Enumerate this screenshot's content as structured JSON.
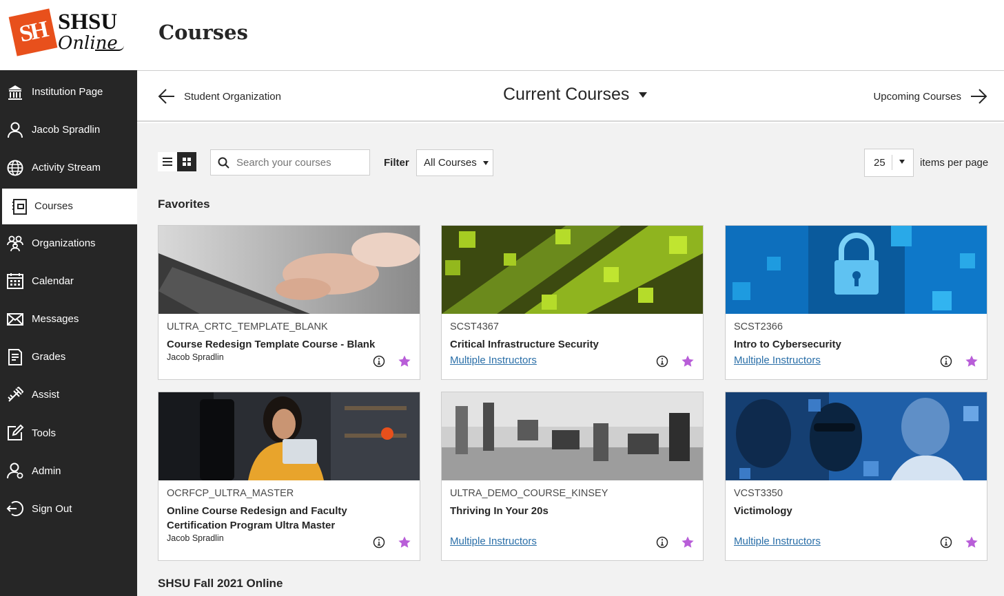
{
  "logo": {
    "mark": "SH",
    "line1": "SHSU",
    "line2": "Online"
  },
  "page_title": "Courses",
  "nav": [
    {
      "label": "Institution Page",
      "icon": "institution-icon"
    },
    {
      "label": "Jacob Spradlin",
      "icon": "user-icon"
    },
    {
      "label": "Activity Stream",
      "icon": "globe-icon"
    },
    {
      "label": "Courses",
      "icon": "courses-icon"
    },
    {
      "label": "Organizations",
      "icon": "organizations-icon"
    },
    {
      "label": "Calendar",
      "icon": "calendar-icon"
    },
    {
      "label": "Messages",
      "icon": "envelope-icon"
    },
    {
      "label": "Grades",
      "icon": "grades-icon"
    },
    {
      "label": "Assist",
      "icon": "assist-icon"
    },
    {
      "label": "Tools",
      "icon": "tools-icon"
    },
    {
      "label": "Admin",
      "icon": "admin-icon"
    },
    {
      "label": "Sign Out",
      "icon": "sign-out-icon"
    }
  ],
  "active_nav": "Courses",
  "term_nav": {
    "previous": "Student Organization",
    "current": "Current Courses",
    "next": "Upcoming Courses"
  },
  "toolbar": {
    "search_placeholder": "Search your courses",
    "filter_label": "Filter",
    "filter_value": "All Courses",
    "items_per_page_value": "25",
    "items_per_page_label": "items per page"
  },
  "sections": {
    "favorites": "Favorites",
    "term": "SHSU Fall 2021 Online"
  },
  "courses": [
    {
      "id": "ULTRA_CRTC_TEMPLATE_BLANK",
      "name": "Course Redesign Template Course - Blank",
      "instructor": "Jacob Spradlin",
      "instructor_link": false,
      "favorite": true,
      "thumb": "typing-hands"
    },
    {
      "id": "SCST4367",
      "name": "Critical Infrastructure Security",
      "instructor": "Multiple Instructors",
      "instructor_link": true,
      "favorite": true,
      "thumb": "green-city"
    },
    {
      "id": "SCST2366",
      "name": "Intro to Cybersecurity",
      "instructor": "Multiple Instructors",
      "instructor_link": true,
      "favorite": true,
      "thumb": "blue-lock"
    },
    {
      "id": "OCRFCP_ULTRA_MASTER",
      "name": "Online Course Redesign and Faculty Certification Program Ultra Master",
      "instructor": "Jacob Spradlin",
      "instructor_link": false,
      "favorite": true,
      "thumb": "woman-tablet"
    },
    {
      "id": "ULTRA_DEMO_COURSE_KINSEY",
      "name": "Thriving In Your 20s",
      "instructor": "Multiple Instructors",
      "instructor_link": true,
      "favorite": true,
      "thumb": "office"
    },
    {
      "id": "VCST3350",
      "name": "Victimology",
      "instructor": "Multiple Instructors",
      "instructor_link": true,
      "favorite": true,
      "thumb": "blue-people"
    }
  ],
  "colors": {
    "sidebar": "#262626",
    "brand_orange": "#e8501c",
    "link": "#2a6fa8",
    "favorite_star": "#b85ed8"
  }
}
